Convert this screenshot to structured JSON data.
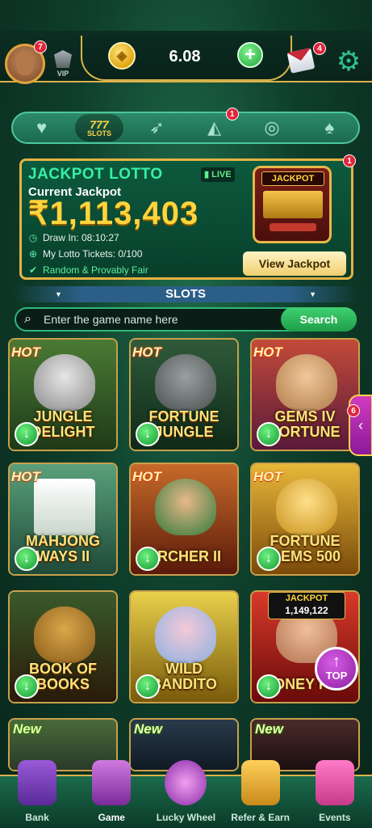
{
  "header": {
    "avatar_badge": "7",
    "vip_label": "VIP",
    "balance": "6.08",
    "add_label": "+",
    "mail_badge": "4"
  },
  "tabs": [
    {
      "name": "favorites",
      "icon": "heart-icon"
    },
    {
      "name": "slots",
      "icon": "slots-777-icon",
      "label": "777",
      "sublabel": "SLOTS",
      "active": true
    },
    {
      "name": "crash",
      "icon": "rocket-icon"
    },
    {
      "name": "fishing",
      "icon": "shark-icon",
      "badge": "1"
    },
    {
      "name": "live",
      "icon": "roulette-icon"
    },
    {
      "name": "cards",
      "icon": "playing-cards-icon"
    }
  ],
  "jackpot": {
    "title": "JACKPOT LOTTO",
    "live": "LIVE",
    "current_label": "Current Jackpot",
    "amount": "₹1,113,403",
    "draw_in": "Draw In: 08:10:27",
    "tickets": "My Lotto Tickets: 0/100",
    "fair": "Random & Provably Fair",
    "machine_label": "JACKPOT",
    "view_button": "View Jackpot",
    "badge": "1"
  },
  "slots_section": {
    "title": "SLOTS"
  },
  "search": {
    "placeholder": "Enter the game name here",
    "button": "Search"
  },
  "games": [
    {
      "title": "JUNGLE DELIGHT",
      "tag": "HOT",
      "color": "#3d6b2a"
    },
    {
      "title": "FORTUNE JUNGLE",
      "tag": "HOT",
      "color": "#2f5a3a"
    },
    {
      "title": "GEMS IV FORTUNE",
      "tag": "HOT",
      "color": "#7a2a4a"
    },
    {
      "title": "MAHJONG WAYS II",
      "tag": "HOT",
      "color": "#3a7a5a"
    },
    {
      "title": "ARCHER II",
      "tag": "HOT",
      "color": "#8a3a1a"
    },
    {
      "title": "FORTUNE GEMS 500",
      "tag": "HOT",
      "color": "#8a5a14"
    },
    {
      "title": "BOOK OF BOOKS",
      "tag": "",
      "color": "#5a3a1a"
    },
    {
      "title": "WILD BANDITO",
      "tag": "",
      "color": "#b89a2a"
    },
    {
      "title": "MONEY POT",
      "tag": "",
      "color": "#a31c1c",
      "jackpot_label": "JACKPOT",
      "jackpot_value": "1,149,122"
    },
    {
      "title": "",
      "tag": "New",
      "color": "#2a4a3a"
    },
    {
      "title": "",
      "tag": "New",
      "color": "#1f2f3f"
    },
    {
      "title": "",
      "tag": "New",
      "color": "#3a2a2a"
    }
  ],
  "side_tab_badge": "6",
  "top_button": "TOP",
  "bottom_nav": [
    {
      "label": "Bank",
      "icon": "bank-icon",
      "color": "#7b3fb8"
    },
    {
      "label": "Game",
      "icon": "game-icon",
      "color": "#b050c8",
      "active": true
    },
    {
      "label": "Lucky Wheel",
      "icon": "lucky-wheel-icon",
      "color": "#c84fd1"
    },
    {
      "label": "Refer & Earn",
      "icon": "refer-icon",
      "color": "#e8a43a"
    },
    {
      "label": "Events",
      "icon": "gift-icon",
      "color": "#e14ea8"
    }
  ]
}
